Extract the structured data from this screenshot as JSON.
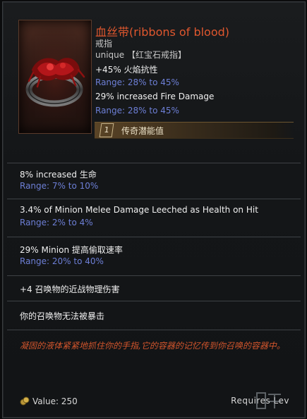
{
  "item": {
    "name": "血丝带(ribbons of blood)",
    "type": "戒指",
    "rarity": "unique 【红宝石戒指】",
    "implicits": [
      {
        "text": "+45% 火焰抗性",
        "range": "Range: 28% to 45%"
      },
      {
        "text": "29% increased Fire Damage",
        "range": "Range: 28% to 45%"
      }
    ],
    "legendary": {
      "badge": "1",
      "label": "传奇潜能值"
    }
  },
  "affixes": [
    {
      "text": "8% increased 生命",
      "range": "Range: 7% to 10%"
    },
    {
      "text": "3.4% of Minion Melee Damage Leeched as Health on Hit",
      "range": "Range: 2% to 4%"
    },
    {
      "text": "29% Minion 提高偷取速率",
      "range": "Range: 20% to 40%"
    },
    {
      "text": "+4 召唤物的近战物理伤害"
    },
    {
      "text": "你的召唤物无法被暴击"
    }
  ],
  "lore": "凝固的液体紧紧地抓住你的手指,它的容器的记忆传到你召唤的容器中。",
  "footer": {
    "value": "Value: 250",
    "requires": "Requires Lev",
    "coin_icon": "coin-icon"
  },
  "colors": {
    "unique_name": "#e0572e",
    "range": "#6d7fd6",
    "lore": "#d2552c",
    "legendary_bar": "#5a4426"
  }
}
